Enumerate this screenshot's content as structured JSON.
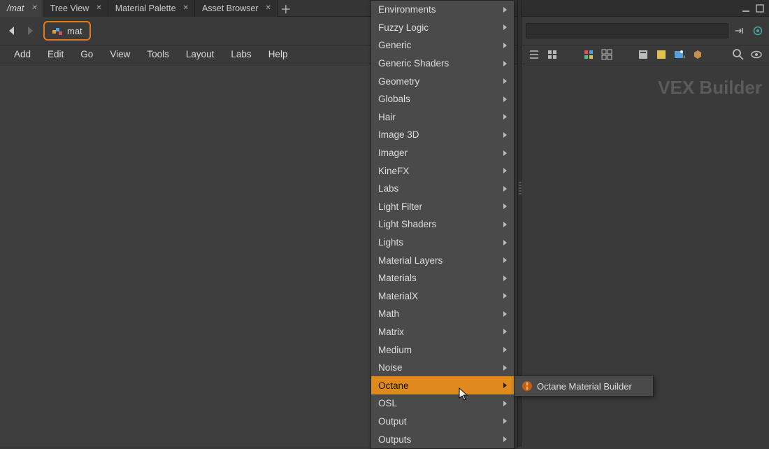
{
  "tabs": [
    {
      "label": "/mat",
      "active": true
    },
    {
      "label": "Tree View",
      "active": false
    },
    {
      "label": "Material Palette",
      "active": false
    },
    {
      "label": "Asset Browser",
      "active": false
    }
  ],
  "path": {
    "name": "mat"
  },
  "menubar": [
    "Add",
    "Edit",
    "Go",
    "View",
    "Tools",
    "Layout",
    "Labs",
    "Help"
  ],
  "dropdown": {
    "items": [
      "Environments",
      "Fuzzy Logic",
      "Generic",
      "Generic Shaders",
      "Geometry",
      "Globals",
      "Hair",
      "Image 3D",
      "Imager",
      "KineFX",
      "Labs",
      "Light Filter",
      "Light Shaders",
      "Lights",
      "Material Layers",
      "Materials",
      "MaterialX",
      "Math",
      "Matrix",
      "Medium",
      "Noise",
      "Octane",
      "OSL",
      "Output",
      "Outputs"
    ],
    "highlighted_index": 21
  },
  "submenu": {
    "items": [
      "Octane Material Builder"
    ]
  },
  "right_panel": {
    "watermark": "VEX Builder"
  }
}
